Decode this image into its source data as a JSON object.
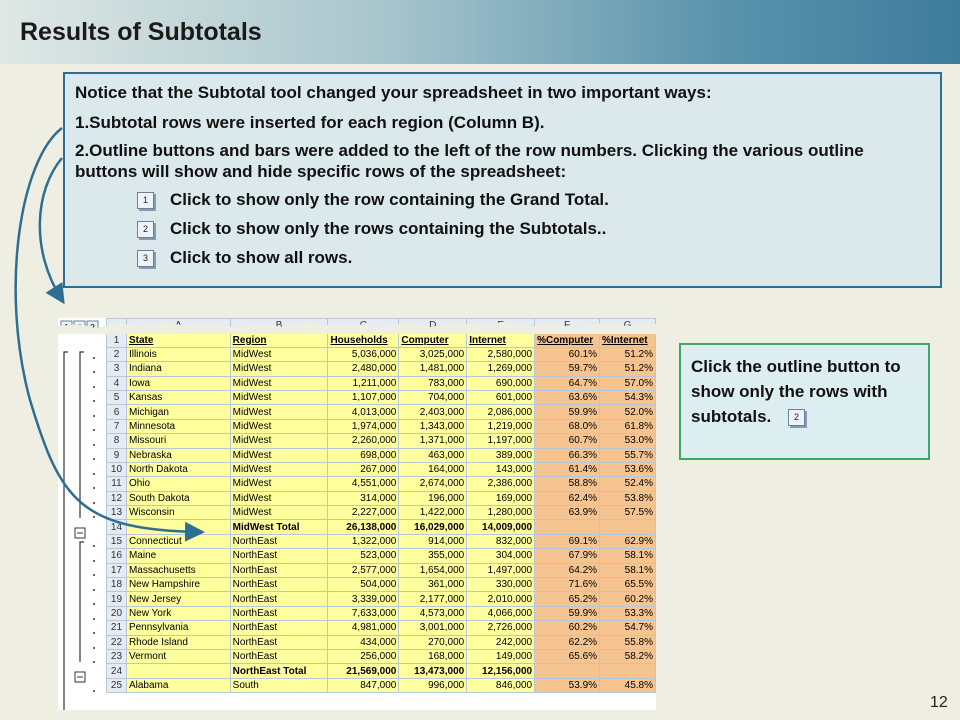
{
  "title": "Results of Subtotals",
  "page_number": "12",
  "notice": {
    "intro": "Notice that the Subtotal tool changed your spreadsheet in two important ways:",
    "point1": "1.Subtotal rows were inserted for each region (Column B).",
    "point2": "2.Outline buttons and bars were added to the left of the row numbers.  Clicking the various outline buttons will show and hide specific rows of the spreadsheet:",
    "buttons": [
      {
        "num": "1",
        "text": "Click to show only the row containing the Grand Total."
      },
      {
        "num": "2",
        "text": "Click to show only the rows containing the Subtotals.."
      },
      {
        "num": "3",
        "text": "Click to show all rows."
      }
    ]
  },
  "callout": {
    "text": "Click the outline button to show only the rows with subtotals.",
    "button": "2"
  },
  "sheet": {
    "outline_levels": [
      "1",
      "2",
      "3"
    ],
    "columns": [
      "A",
      "B",
      "C",
      "D",
      "E",
      "F",
      "G"
    ],
    "header": [
      "State",
      "Region",
      "Households",
      "Computer",
      "Internet",
      "%Computer",
      "%Internet"
    ],
    "rows": [
      {
        "n": "2",
        "cells": [
          "Illinois",
          "MidWest",
          "5,036,000",
          "3,025,000",
          "2,580,000",
          "60.1%",
          "51.2%"
        ]
      },
      {
        "n": "3",
        "cells": [
          "Indiana",
          "MidWest",
          "2,480,000",
          "1,481,000",
          "1,269,000",
          "59.7%",
          "51.2%"
        ]
      },
      {
        "n": "4",
        "cells": [
          "Iowa",
          "MidWest",
          "1,211,000",
          "783,000",
          "690,000",
          "64.7%",
          "57.0%"
        ]
      },
      {
        "n": "5",
        "cells": [
          "Kansas",
          "MidWest",
          "1,107,000",
          "704,000",
          "601,000",
          "63.6%",
          "54.3%"
        ]
      },
      {
        "n": "6",
        "cells": [
          "Michigan",
          "MidWest",
          "4,013,000",
          "2,403,000",
          "2,086,000",
          "59.9%",
          "52.0%"
        ]
      },
      {
        "n": "7",
        "cells": [
          "Minnesota",
          "MidWest",
          "1,974,000",
          "1,343,000",
          "1,219,000",
          "68.0%",
          "61.8%"
        ]
      },
      {
        "n": "8",
        "cells": [
          "Missouri",
          "MidWest",
          "2,260,000",
          "1,371,000",
          "1,197,000",
          "60.7%",
          "53.0%"
        ]
      },
      {
        "n": "9",
        "cells": [
          "Nebraska",
          "MidWest",
          "698,000",
          "463,000",
          "389,000",
          "66.3%",
          "55.7%"
        ]
      },
      {
        "n": "10",
        "cells": [
          "North Dakota",
          "MidWest",
          "267,000",
          "164,000",
          "143,000",
          "61.4%",
          "53.6%"
        ]
      },
      {
        "n": "11",
        "cells": [
          "Ohio",
          "MidWest",
          "4,551,000",
          "2,674,000",
          "2,386,000",
          "58.8%",
          "52.4%"
        ]
      },
      {
        "n": "12",
        "cells": [
          "South Dakota",
          "MidWest",
          "314,000",
          "196,000",
          "169,000",
          "62.4%",
          "53.8%"
        ]
      },
      {
        "n": "13",
        "cells": [
          "Wisconsin",
          "MidWest",
          "2,227,000",
          "1,422,000",
          "1,280,000",
          "63.9%",
          "57.5%"
        ]
      },
      {
        "n": "14",
        "sub": true,
        "cells": [
          "",
          "MidWest Total",
          "26,138,000",
          "16,029,000",
          "14,009,000",
          "",
          ""
        ]
      },
      {
        "n": "15",
        "cells": [
          "Connecticut",
          "NorthEast",
          "1,322,000",
          "914,000",
          "832,000",
          "69.1%",
          "62.9%"
        ]
      },
      {
        "n": "16",
        "cells": [
          "Maine",
          "NorthEast",
          "523,000",
          "355,000",
          "304,000",
          "67.9%",
          "58.1%"
        ]
      },
      {
        "n": "17",
        "cells": [
          "Massachusetts",
          "NorthEast",
          "2,577,000",
          "1,654,000",
          "1,497,000",
          "64.2%",
          "58.1%"
        ]
      },
      {
        "n": "18",
        "cells": [
          "New Hampshire",
          "NorthEast",
          "504,000",
          "361,000",
          "330,000",
          "71.6%",
          "65.5%"
        ]
      },
      {
        "n": "19",
        "cells": [
          "New Jersey",
          "NorthEast",
          "3,339,000",
          "2,177,000",
          "2,010,000",
          "65.2%",
          "60.2%"
        ]
      },
      {
        "n": "20",
        "cells": [
          "New York",
          "NorthEast",
          "7,633,000",
          "4,573,000",
          "4,066,000",
          "59.9%",
          "53.3%"
        ]
      },
      {
        "n": "21",
        "cells": [
          "Pennsylvania",
          "NorthEast",
          "4,981,000",
          "3,001,000",
          "2,726,000",
          "60.2%",
          "54.7%"
        ]
      },
      {
        "n": "22",
        "cells": [
          "Rhode Island",
          "NorthEast",
          "434,000",
          "270,000",
          "242,000",
          "62.2%",
          "55.8%"
        ]
      },
      {
        "n": "23",
        "cells": [
          "Vermont",
          "NorthEast",
          "256,000",
          "168,000",
          "149,000",
          "65.6%",
          "58.2%"
        ]
      },
      {
        "n": "24",
        "sub": true,
        "cells": [
          "",
          "NorthEast Total",
          "21,569,000",
          "13,473,000",
          "12,156,000",
          "",
          ""
        ]
      },
      {
        "n": "25",
        "cells": [
          "Alabama",
          "South",
          "847,000",
          "996,000",
          "846,000",
          "53.9%",
          "45.8%"
        ]
      }
    ]
  }
}
